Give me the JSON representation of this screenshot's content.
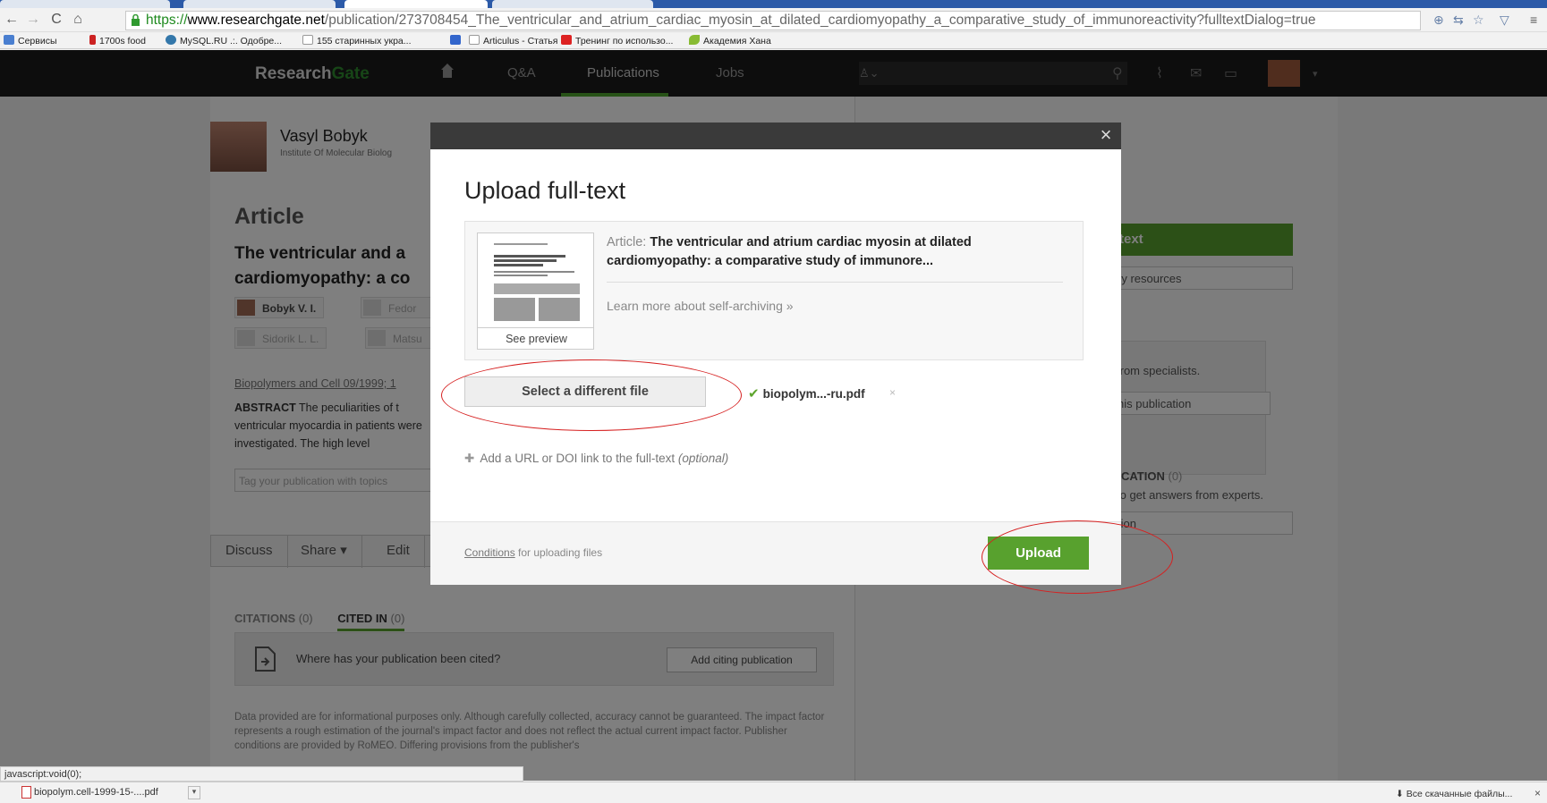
{
  "browser": {
    "url": {
      "scheme": "https://",
      "host": "www.researchgate.net",
      "path": "/publication/273708454_The_ventricular_and_atrium_cardiac_myosin_at_dilated_cardiomyopathy_a_comparative_study_of_immunoreactivity?fulltextDialog=true"
    },
    "bookmarks": [
      {
        "label": "Сервисы",
        "color": "#4a7fd0"
      },
      {
        "label": "1700s food",
        "color": "#cc2222"
      },
      {
        "label": "MySQL.RU .:. Одобре...",
        "color": "#3377aa"
      },
      {
        "label": "155 старинных укра...",
        "color": "#dddddd"
      },
      {
        "label": "",
        "color": "#3366cc"
      },
      {
        "label": "Articulus - Статья",
        "color": "#dddddd"
      },
      {
        "label": "Тренинг по использо...",
        "color": "#dd2222"
      },
      {
        "label": "Академия Хана",
        "color": "#88bb33"
      }
    ]
  },
  "rg": {
    "logo_research": "Research",
    "logo_gate": "Gate",
    "nav": {
      "qa": "Q&A",
      "publications": "Publications",
      "jobs": "Jobs"
    },
    "profile": {
      "name": "Vasyl Bobyk",
      "institute": "Institute Of Molecular Biolog"
    },
    "article": {
      "label": "Article",
      "title": "The ventricular and a cardiomyopathy: a co",
      "authors": [
        "Bobyk V. I.",
        "Fedor",
        "Sidorik L. L.",
        "Matsu"
      ],
      "journal": "Biopolymers and Cell 09/1999; 1",
      "abstract_label": "ABSTRACT",
      "abstract": "The peculiarities of t ventricular myocardia in patients were investigated. The high level",
      "tag_placeholder": "Tag your publication with topics"
    },
    "actions": [
      "Discuss",
      "Share ▾",
      "Edit"
    ],
    "citations": {
      "tab_citations": "CITATIONS",
      "tab_citations_count": "(0)",
      "tab_cited_in": "CITED IN",
      "tab_cited_in_count": "(0)",
      "question": "Where has your publication been cited?",
      "add_button": "Add citing publication"
    },
    "disclaimer": "Data provided are for informational purposes only. Although carefully collected, accuracy cannot be guaranteed. The impact factor represents a rough estimation of the journal's impact factor and does not reflect the actual current impact factor. Publisher conditions are provided by RoMEO. Differing provisions from the publisher's",
    "sidebar": {
      "fulltext_btn": "-text",
      "resources_btn": "ry resources",
      "specialists": "from specialists.",
      "this_pub_btn": "his publication",
      "cation_heading": "CATION",
      "cation_count": "(0)",
      "experts": "to get answers from experts.",
      "tion_btn": "tion"
    }
  },
  "modal": {
    "title": "Upload full-text",
    "article_prefix": "Article:",
    "article_title": "The ventricular and atrium cardiac myosin at dilated cardiomyopathy: a comparative study of immunore...",
    "see_preview": "See preview",
    "learn_more": "Learn more about self-archiving »",
    "select_file": "Select a different file",
    "file_name": "biopolym...-ru.pdf",
    "file_remove": "×",
    "add_url": "Add a URL or DOI link to the full-text",
    "add_url_optional": "(optional)",
    "conditions_link": "Conditions",
    "conditions_rest": " for uploading files",
    "upload": "Upload",
    "close": "×"
  },
  "status": {
    "link": "javascript:void(0);",
    "download_file": "biopolym.cell-1999-15-....pdf",
    "all_downloads": "Все скачанные файлы...",
    "close": "×"
  },
  "colors": {
    "accent_green": "#58a12e",
    "annotation_red": "#d62020",
    "tab_blue": "#2c5aa8"
  }
}
